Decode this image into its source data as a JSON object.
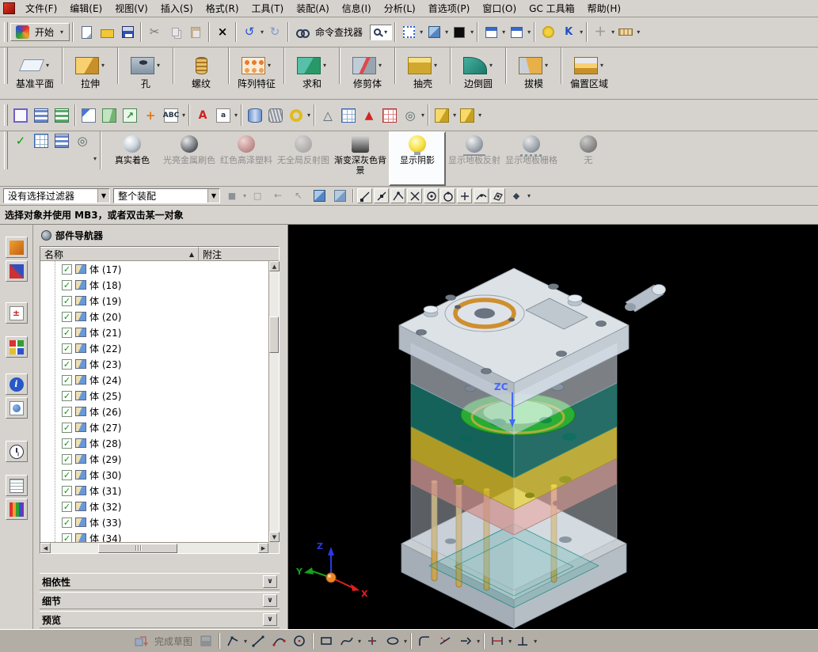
{
  "menubar": {
    "items": [
      "文件(F)",
      "编辑(E)",
      "视图(V)",
      "插入(S)",
      "格式(R)",
      "工具(T)",
      "装配(A)",
      "信息(I)",
      "分析(L)",
      "首选项(P)",
      "窗口(O)",
      "GC 工具箱",
      "帮助(H)"
    ]
  },
  "main_toolbar": {
    "start_label": "开始",
    "command_finder_label": "命令查找器"
  },
  "feature_toolbar": {
    "items": [
      "基准平面",
      "拉伸",
      "孔",
      "螺纹",
      "阵列特征",
      "求和",
      "修剪体",
      "抽壳",
      "边倒圆",
      "拔模",
      "偏置区域"
    ]
  },
  "render_toolbar": {
    "items": [
      "真实着色",
      "光亮金属刷色",
      "红色高泽塑料",
      "无全局反射图",
      "渐变深灰色背景",
      "显示阴影",
      "显示地板反射",
      "显示地板栅格",
      "无"
    ]
  },
  "selection_bar": {
    "filter_value": "没有选择过滤器",
    "scope_value": "整个装配"
  },
  "prompt_bar": {
    "message": "选择对象并使用 MB3，或者双击某一对象"
  },
  "navigator": {
    "title": "部件导航器",
    "name_column": "名称",
    "note_column": "附注",
    "items": [
      "体 (17)",
      "体 (18)",
      "体 (19)",
      "体 (20)",
      "体 (21)",
      "体 (22)",
      "体 (23)",
      "体 (24)",
      "体 (25)",
      "体 (26)",
      "体 (27)",
      "体 (28)",
      "体 (29)",
      "体 (30)",
      "体 (31)",
      "体 (32)",
      "体 (33)",
      "体 (34)"
    ],
    "sections": [
      "相依性",
      "细节",
      "预览"
    ]
  },
  "viewport": {
    "zc_label": "ZC",
    "axis_x": "X",
    "axis_y": "Y",
    "axis_z": "Z"
  },
  "bottom_toolbar": {
    "finish_sketch_label": "完成草图"
  }
}
